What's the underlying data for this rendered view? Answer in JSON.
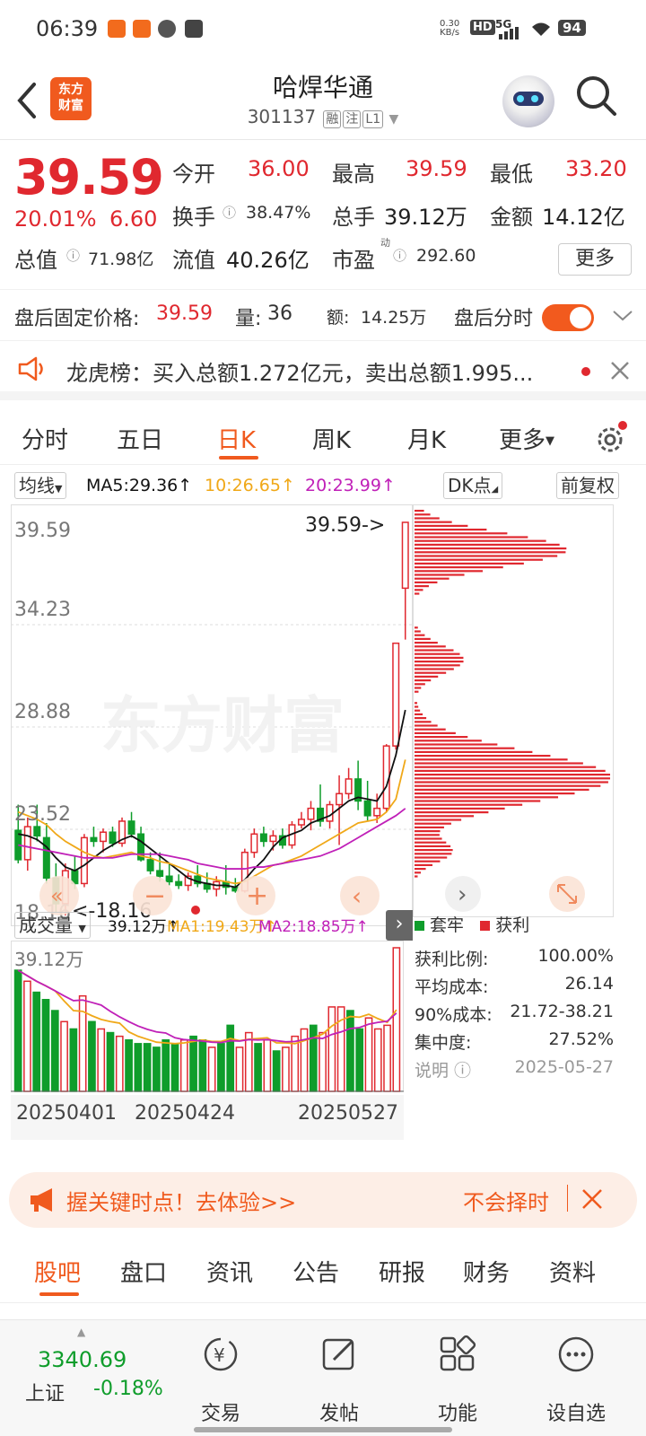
{
  "status_bar": {
    "time": "06:39",
    "net_speed_top": "0.30",
    "net_speed_bottom": "KB/s",
    "hd": "HD",
    "signal": "5G",
    "battery": "94"
  },
  "header": {
    "back_icon": "chevron-left-icon",
    "logo_line1": "东方",
    "logo_line2": "财富",
    "stock_name": "哈焊华通",
    "stock_code": "301137",
    "tag_margin": "融",
    "tag_note": "注",
    "tag_level": "L1"
  },
  "quote": {
    "price": "39.59",
    "change_pct": "20.01%",
    "change": "6.60",
    "open_label": "今开",
    "open": "36.00",
    "high_label": "最高",
    "high": "39.59",
    "low_label": "最低",
    "low": "33.20",
    "turnover_label": "换手",
    "turnover": "38.47%",
    "volume_label": "总手",
    "volume": "39.12万",
    "amount_label": "金额",
    "amount": "14.12亿",
    "mcap_label": "总值",
    "mcap": "71.98亿",
    "float_label": "流值",
    "float": "40.26亿",
    "pe_label": "市盈",
    "pe_sup": "动",
    "pe": "292.60",
    "more_label": "更多"
  },
  "after_hours": {
    "price_label": "盘后固定价格:",
    "price": "39.59",
    "vol_label": "量:",
    "vol": "36",
    "amt_label": "额:",
    "amt": "14.25万",
    "timeshare_label": "盘后分时"
  },
  "notice": {
    "text": "龙虎榜：买入总额1.272亿元，卖出总额1.995..."
  },
  "chart_tabs": [
    "分时",
    "五日",
    "日K",
    "周K",
    "月K",
    "更多"
  ],
  "kline": {
    "ma_select": "均线",
    "ma5": "MA5:29.36",
    "ma10": "10:26.65",
    "ma20": "20:23.99",
    "dk_label": "DK点",
    "fq_label": "前复权",
    "y_labels": [
      "39.59",
      "34.23",
      "28.88",
      "23.52",
      "18.16"
    ],
    "max_marker": "39.59->",
    "min_marker": "<-18.16",
    "watermark": "东方财富",
    "vol_select": "成交量",
    "vol_value": "39.12万",
    "vol_ma1": "MA1:19.43万",
    "vol_ma2": "MA2:18.85万",
    "vol_max_label": "39.12万",
    "dates": [
      "20250401",
      "20250424",
      "20250527"
    ]
  },
  "chip": {
    "legend_trapped": "套牢",
    "legend_profit": "获利",
    "rows": [
      {
        "label": "获利比例:",
        "value": "100.00%"
      },
      {
        "label": "平均成本:",
        "value": "26.14"
      },
      {
        "label": "90%成本:",
        "value": "21.72-38.21"
      },
      {
        "label": "集中度:",
        "value": "27.52%"
      }
    ],
    "note_label": "说明",
    "date": "2025-05-27"
  },
  "banner": {
    "text_left": "握关键时点！去体验>>",
    "text_right": "不会择时"
  },
  "bottom_tabs": [
    "股吧",
    "盘口",
    "资讯",
    "公告",
    "研报",
    "财务",
    "资料"
  ],
  "footer": {
    "index_value": "3340.69",
    "index_name": "上证",
    "index_change": "-0.18%",
    "items": [
      {
        "label": "交易",
        "icon": "yuan-cycle-icon"
      },
      {
        "label": "发帖",
        "icon": "edit-icon"
      },
      {
        "label": "功能",
        "icon": "grid-icon"
      },
      {
        "label": "设自选",
        "icon": "more-dots-icon"
      }
    ]
  },
  "colors": {
    "up": "#e0282f",
    "down": "#0f9d2b",
    "accent": "#f05a1e",
    "ma5": "#111111",
    "ma10": "#f0a818",
    "ma20": "#c020b8"
  },
  "chart_data": {
    "type": "candlestick",
    "note": "Daily K-line, approximate OHLC read from chart",
    "ohlc": [
      [
        22.8,
        24.2,
        21.0,
        21.2
      ],
      [
        21.2,
        23.5,
        20.6,
        23.0
      ],
      [
        23.0,
        24.2,
        22.2,
        22.5
      ],
      [
        22.4,
        23.2,
        19.9,
        20.2
      ],
      [
        20.2,
        21.0,
        18.3,
        18.8
      ],
      [
        18.8,
        21.0,
        18.16,
        20.6
      ],
      [
        20.6,
        21.4,
        19.6,
        19.9
      ],
      [
        19.9,
        22.6,
        19.7,
        22.4
      ],
      [
        22.4,
        23.0,
        21.9,
        22.2
      ],
      [
        22.2,
        22.9,
        21.6,
        22.7
      ],
      [
        22.7,
        23.0,
        21.9,
        22.1
      ],
      [
        22.1,
        23.5,
        21.9,
        23.3
      ],
      [
        23.3,
        23.8,
        22.4,
        22.6
      ],
      [
        22.6,
        23.0,
        21.1,
        21.2
      ],
      [
        21.2,
        21.6,
        20.4,
        20.6
      ],
      [
        20.6,
        21.6,
        20.0,
        20.3
      ],
      [
        20.3,
        21.0,
        19.8,
        20.0
      ],
      [
        20.0,
        20.4,
        19.6,
        19.8
      ],
      [
        19.8,
        20.5,
        19.5,
        20.3
      ],
      [
        20.3,
        20.9,
        19.7,
        19.9
      ],
      [
        19.9,
        20.5,
        19.4,
        19.6
      ],
      [
        19.6,
        20.3,
        19.2,
        20.0
      ],
      [
        20.0,
        20.9,
        19.3,
        19.7
      ],
      [
        19.7,
        20.2,
        19.4,
        19.5
      ],
      [
        19.5,
        21.8,
        19.4,
        21.6
      ],
      [
        21.6,
        22.9,
        21.3,
        22.6
      ],
      [
        22.6,
        23.0,
        21.9,
        22.2
      ],
      [
        22.2,
        22.8,
        21.7,
        22.5
      ],
      [
        22.5,
        22.9,
        21.8,
        22.0
      ],
      [
        22.0,
        23.3,
        21.8,
        23.1
      ],
      [
        23.1,
        23.8,
        22.9,
        23.4
      ],
      [
        23.4,
        24.4,
        22.8,
        24.0
      ],
      [
        24.0,
        25.3,
        23.0,
        23.3
      ],
      [
        23.3,
        24.4,
        22.9,
        24.2
      ],
      [
        24.2,
        25.8,
        22.0,
        24.8
      ],
      [
        24.8,
        26.2,
        24.5,
        25.6
      ],
      [
        25.6,
        26.6,
        23.9,
        24.4
      ],
      [
        24.4,
        25.5,
        23.3,
        23.6
      ],
      [
        23.6,
        24.8,
        23.2,
        24.0
      ],
      [
        24.0,
        27.5,
        23.8,
        27.4
      ],
      [
        27.4,
        33.0,
        27.2,
        33.0
      ],
      [
        36.0,
        39.59,
        33.2,
        39.59
      ]
    ],
    "ma5": [
      22.6,
      22.5,
      22.3,
      21.9,
      21.3,
      20.8,
      20.6,
      20.9,
      21.3,
      21.7,
      22.0,
      22.3,
      22.5,
      22.2,
      21.8,
      21.4,
      21.0,
      20.6,
      20.2,
      20.0,
      19.9,
      19.8,
      19.8,
      19.7,
      20.1,
      20.7,
      21.2,
      21.9,
      22.4,
      22.6,
      22.8,
      23.2,
      23.4,
      23.6,
      24.0,
      24.4,
      24.6,
      24.5,
      24.4,
      25.2,
      26.9,
      29.36
    ],
    "ma10": [
      23.8,
      23.6,
      23.4,
      23.1,
      22.6,
      22.2,
      21.9,
      21.6,
      21.4,
      21.3,
      21.4,
      21.5,
      21.6,
      21.4,
      21.3,
      21.1,
      21.0,
      20.8,
      20.6,
      20.4,
      20.2,
      20.1,
      20.0,
      19.9,
      20.0,
      20.3,
      20.6,
      20.9,
      21.0,
      21.2,
      21.4,
      21.7,
      22.0,
      22.3,
      22.6,
      22.9,
      23.2,
      23.3,
      23.4,
      23.8,
      24.5,
      26.65
    ],
    "ma20": [
      22.0,
      21.9,
      21.8,
      21.7,
      21.6,
      21.5,
      21.4,
      21.3,
      21.3,
      21.3,
      21.3,
      21.4,
      21.5,
      21.5,
      21.5,
      21.5,
      21.4,
      21.3,
      21.2,
      21.0,
      20.9,
      20.8,
      20.7,
      20.7,
      20.7,
      20.8,
      20.8,
      20.9,
      21.0,
      21.1,
      21.2,
      21.3,
      21.4,
      21.6,
      21.8,
      22.1,
      22.4,
      22.7,
      23.0,
      23.3,
      23.6,
      23.99
    ],
    "volume": [
      33,
      30,
      27,
      25,
      22,
      19,
      17,
      26,
      19,
      17,
      16,
      15,
      14,
      13,
      13,
      12,
      14,
      13,
      14,
      15,
      14,
      12,
      13,
      18,
      12,
      16,
      13,
      14,
      11,
      12,
      15,
      17,
      18,
      16,
      23,
      23,
      22,
      17,
      20,
      17,
      18,
      39.12
    ],
    "ylim": [
      18.16,
      39.59
    ]
  }
}
